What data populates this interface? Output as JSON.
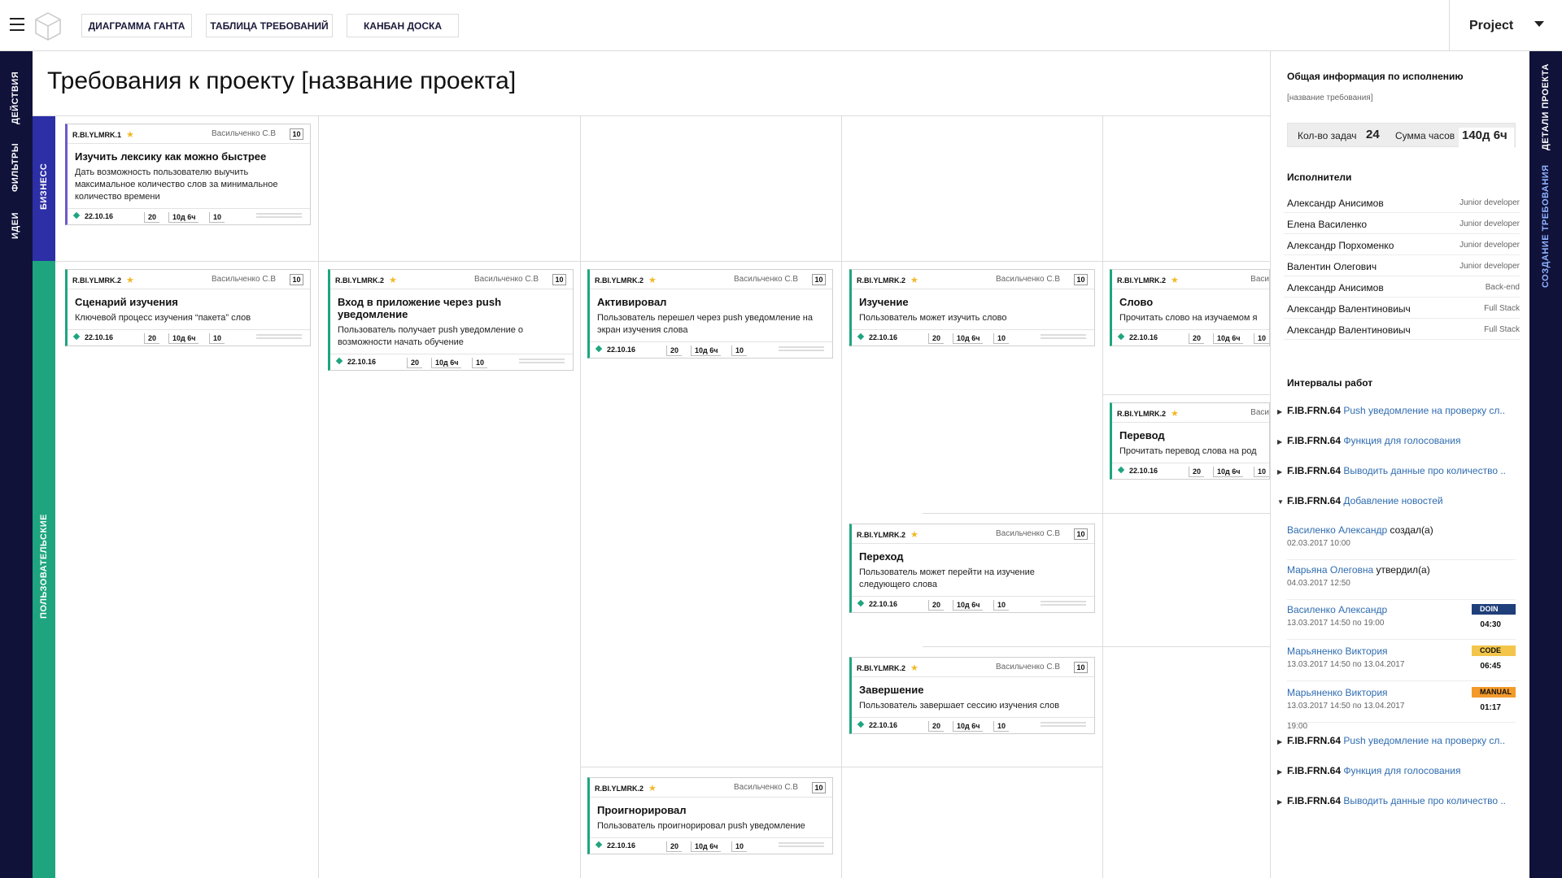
{
  "header": {
    "tabs": [
      "ДИАГРАММА ГАНТА",
      "ТАБЛИЦА ТРЕБОВАНИЙ",
      "КАНБАН ДОСКА"
    ],
    "project_label": "Project"
  },
  "left_nav": [
    "ДЕЙСТВИЯ",
    "ФИЛЬТРЫ",
    "ИДЕИ"
  ],
  "right_nav": [
    "ДЕТАЛИ ПРОЕКТА",
    "СОЗДАНИЕ ТРЕБОВАНИЯ"
  ],
  "page_title": "Требования к проекту [название проекта]",
  "lanes": [
    "БИЗНЕСС",
    "ПОЛЬЗОВАТЕЛЬСКИЕ"
  ],
  "cards": [
    {
      "id": "R.BI.YLMRK.1",
      "owner": "Васильченко С.В",
      "num": "10",
      "title": "Изучить лексику как можно быстрее",
      "desc": "Дать возможность пользователю выучить максимальное количество слов за минимальное количество времени",
      "date": "22.10.16",
      "b1": "20",
      "b2": "10д 6ч",
      "b3": "10"
    },
    {
      "id": "R.BI.YLMRK.2",
      "owner": "Васильченко С.В",
      "num": "10",
      "title": "Сценарий изучения",
      "desc": "Ключевой процесс изучения “пакета” слов",
      "date": "22.10.16",
      "b1": "20",
      "b2": "10д 6ч",
      "b3": "10"
    },
    {
      "id": "R.BI.YLMRK.2",
      "owner": "Васильченко С.В",
      "num": "10",
      "title": "Вход в приложение через push уведомление",
      "desc": "Пользователь получает push уведомление о возможности начать обучение",
      "date": "22.10.16",
      "b1": "20",
      "b2": "10д 6ч",
      "b3": "10"
    },
    {
      "id": "R.BI.YLMRK.2",
      "owner": "Васильченко С.В",
      "num": "10",
      "title": "Активировал",
      "desc": "Пользователь перешел через push уведомление на экран изучения слова",
      "date": "22.10.16",
      "b1": "20",
      "b2": "10д 6ч",
      "b3": "10"
    },
    {
      "id": "R.BI.YLMRK.2",
      "owner": "Васильченко С.В",
      "num": "10",
      "title": "Изучение",
      "desc": "Пользователь может изучить слово",
      "date": "22.10.16",
      "b1": "20",
      "b2": "10д 6ч",
      "b3": "10"
    },
    {
      "id": "R.BI.YLMRK.2",
      "owner": "Васи",
      "num": "",
      "title": "Слово",
      "desc": "Прочитать слово на изучаемом я",
      "date": "22.10.16",
      "b1": "20",
      "b2": "10д 6ч",
      "b3": "10"
    },
    {
      "id": "R.BI.YLMRK.2",
      "owner": "Васи",
      "num": "",
      "title": "Перевод",
      "desc": "Прочитать перевод слова на род",
      "date": "22.10.16",
      "b1": "20",
      "b2": "10д 6ч",
      "b3": "10"
    },
    {
      "id": "R.BI.YLMRK.2",
      "owner": "Васильченко С.В",
      "num": "10",
      "title": "Переход",
      "desc": "Пользователь может перейти на изучение следующего слова",
      "date": "22.10.16",
      "b1": "20",
      "b2": "10д 6ч",
      "b3": "10"
    },
    {
      "id": "R.BI.YLMRK.2",
      "owner": "Васильченко С.В",
      "num": "10",
      "title": "Завершение",
      "desc": "Пользователь завершает сессию изучения слов",
      "date": "22.10.16",
      "b1": "20",
      "b2": "10д 6ч",
      "b3": "10"
    },
    {
      "id": "R.BI.YLMRK.2",
      "owner": "Васильченко С.В",
      "num": "10",
      "title": "Проигнорировал",
      "desc": "Пользователь проигнорировал push уведомление",
      "date": "22.10.16",
      "b1": "20",
      "b2": "10д 6ч",
      "b3": "10"
    }
  ],
  "panel": {
    "heading": "Общая информация по исполнению",
    "subtitle": "[название требования]",
    "tasks_label": "Кол-во задач",
    "tasks_value": "24",
    "hours_label": "Сумма часов",
    "hours_value": "140д 6ч",
    "performers_heading": "Исполнители",
    "performers": [
      {
        "name": "Александр Анисимов",
        "role": "Junior developer"
      },
      {
        "name": "Елена Василенко",
        "role": "Junior developer"
      },
      {
        "name": "Александр Порхоменко",
        "role": "Junior developer"
      },
      {
        "name": "Валентин Олегович",
        "role": "Junior developer"
      },
      {
        "name": "Александр Анисимов",
        "role": "Back-end"
      },
      {
        "name": "Александр Валентиновиыч",
        "role": "Full Stack"
      },
      {
        "name": "Александр Валентиновиыч",
        "role": "Full Stack"
      }
    ],
    "intervals_heading": "Интервалы работ",
    "intervals_top": [
      {
        "code": "F.IB.FRN.64",
        "text": "Push уведомление на проверку сл.."
      },
      {
        "code": "F.IB.FRN.64",
        "text": "Функция для голосования"
      },
      {
        "code": "F.IB.FRN.64",
        "text": "Выводить данные про количество .."
      },
      {
        "code": "F.IB.FRN.64",
        "text": "Добавление новостей"
      }
    ],
    "log": [
      {
        "who": "Василенко Александр",
        "action": "создал(а)",
        "when": "02.03.2017 10:00",
        "tag": "",
        "tag_color": "",
        "dur": ""
      },
      {
        "who": "Марьяна Олеговна",
        "action": "утвердил(а)",
        "when": "04.03.2017 12:50",
        "tag": "",
        "tag_color": "",
        "dur": ""
      },
      {
        "who": "Василенко Александр",
        "action": "",
        "when": "13.03.2017 14:50 по 19:00",
        "tag": "DOIN",
        "tag_color": "#1f3f7a",
        "dur": "04:30"
      },
      {
        "who": "Марьяненко Виктория",
        "action": "",
        "when": "13.03.2017 14:50 по 13.04.2017",
        "tag": "CODE",
        "tag_color": "#f3c64b",
        "dur": "06:45"
      },
      {
        "who": "Марьяненко Виктория",
        "action": "",
        "when": "13.03.2017 14:50 по 13.04.2017",
        "tag": "MANUAL",
        "tag_color": "#f39a2b",
        "dur": "01:17"
      }
    ],
    "log_tail_time": "19:00",
    "intervals_bottom": [
      {
        "code": "F.IB.FRN.64",
        "text": "Push уведомление на проверку сл.."
      },
      {
        "code": "F.IB.FRN.64",
        "text": "Функция для голосования"
      },
      {
        "code": "F.IB.FRN.64",
        "text": "Выводить данные про количество .."
      }
    ]
  }
}
